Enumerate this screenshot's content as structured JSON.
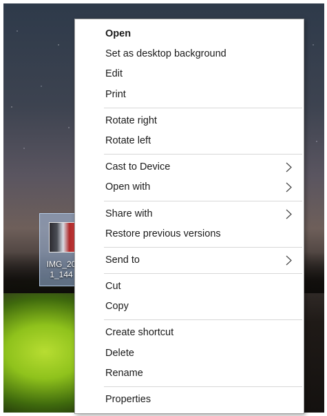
{
  "desktop_file": {
    "label": "IMG_20\n1_144"
  },
  "menu": {
    "groups": [
      [
        {
          "label": "Open",
          "bold": true
        },
        {
          "label": "Set as desktop background"
        },
        {
          "label": "Edit"
        },
        {
          "label": "Print"
        }
      ],
      [
        {
          "label": "Rotate right"
        },
        {
          "label": "Rotate left"
        }
      ],
      [
        {
          "label": "Cast to Device",
          "submenu": true
        },
        {
          "label": "Open with",
          "submenu": true
        }
      ],
      [
        {
          "label": "Share with",
          "submenu": true
        },
        {
          "label": "Restore previous versions"
        }
      ],
      [
        {
          "label": "Send to",
          "submenu": true
        }
      ],
      [
        {
          "label": "Cut"
        },
        {
          "label": "Copy"
        }
      ],
      [
        {
          "label": "Create shortcut"
        },
        {
          "label": "Delete"
        },
        {
          "label": "Rename"
        }
      ],
      [
        {
          "label": "Properties"
        }
      ]
    ],
    "submenu_icon": "chevron-right-icon"
  }
}
